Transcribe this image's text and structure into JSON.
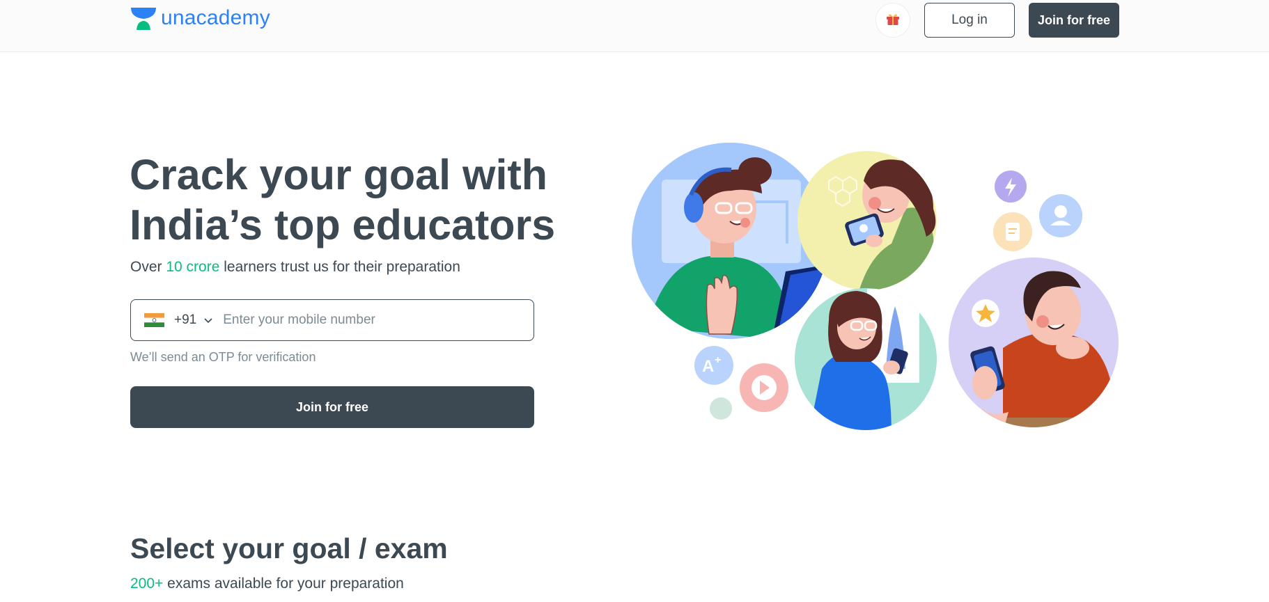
{
  "header": {
    "logo_text": "unacademy",
    "login_label": "Log in",
    "join_label": "Join for free",
    "gift_icon": "gift-icon"
  },
  "hero": {
    "title_line1": "Crack your goal with",
    "title_line2": "India’s top educators",
    "subtitle_before": "Over ",
    "subtitle_highlight": "10 crore",
    "subtitle_after": " learners trust us for their preparation",
    "country_code": "+91",
    "phone_placeholder": "Enter your mobile number",
    "otp_note": "We’ll send an OTP for verification",
    "join_label": "Join for free"
  },
  "goals": {
    "title": "Select your goal / exam",
    "subtitle_highlight": "200+",
    "subtitle_after": " exams available for your preparation"
  },
  "colors": {
    "primary_dark": "#3c4852",
    "brand_blue": "#2d81f7",
    "brand_green": "#08bd80"
  }
}
